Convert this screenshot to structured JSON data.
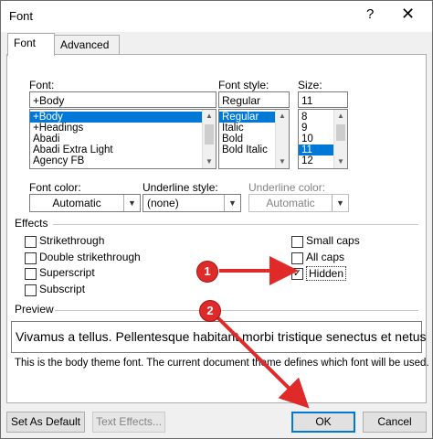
{
  "window": {
    "title": "Font",
    "help_label": "?",
    "close_label": "✕"
  },
  "tabs": [
    {
      "label": "Font",
      "active": true
    },
    {
      "label": "Advanced",
      "active": false
    }
  ],
  "font": {
    "label": "Font:",
    "value": "+Body",
    "options": [
      "+Body",
      "+Headings",
      "Abadi",
      "Abadi Extra Light",
      "Agency FB"
    ],
    "selected": "+Body"
  },
  "font_style": {
    "label": "Font style:",
    "value": "Regular",
    "options": [
      "Regular",
      "Italic",
      "Bold",
      "Bold Italic"
    ],
    "selected": "Regular"
  },
  "size": {
    "label": "Size:",
    "value": "11",
    "options": [
      "8",
      "9",
      "10",
      "11",
      "12"
    ],
    "selected": "11"
  },
  "font_color": {
    "label": "Font color:",
    "value": "Automatic"
  },
  "underline_style": {
    "label": "Underline style:",
    "value": "(none)"
  },
  "underline_color": {
    "label": "Underline color:",
    "value": "Automatic"
  },
  "effects": {
    "label": "Effects",
    "left": [
      {
        "label": "Strikethrough",
        "checked": false
      },
      {
        "label": "Double strikethrough",
        "checked": false
      },
      {
        "label": "Superscript",
        "checked": false
      },
      {
        "label": "Subscript",
        "checked": false
      }
    ],
    "right": [
      {
        "label": "Small caps",
        "checked": false
      },
      {
        "label": "All caps",
        "checked": false
      },
      {
        "label": "Hidden",
        "checked": true
      }
    ]
  },
  "preview": {
    "label": "Preview",
    "text": "Vivamus a tellus. Pellentesque habitant morbi tristique senectus et netus",
    "note": "This is the body theme font. The current document theme defines which font will be used."
  },
  "buttons": {
    "set_default": "Set As Default",
    "text_effects": "Text Effects...",
    "ok": "OK",
    "cancel": "Cancel"
  },
  "annotations": [
    {
      "number": "1"
    },
    {
      "number": "2"
    }
  ],
  "colors": {
    "accent": "#0078d7",
    "annotation": "#e02a2a"
  }
}
